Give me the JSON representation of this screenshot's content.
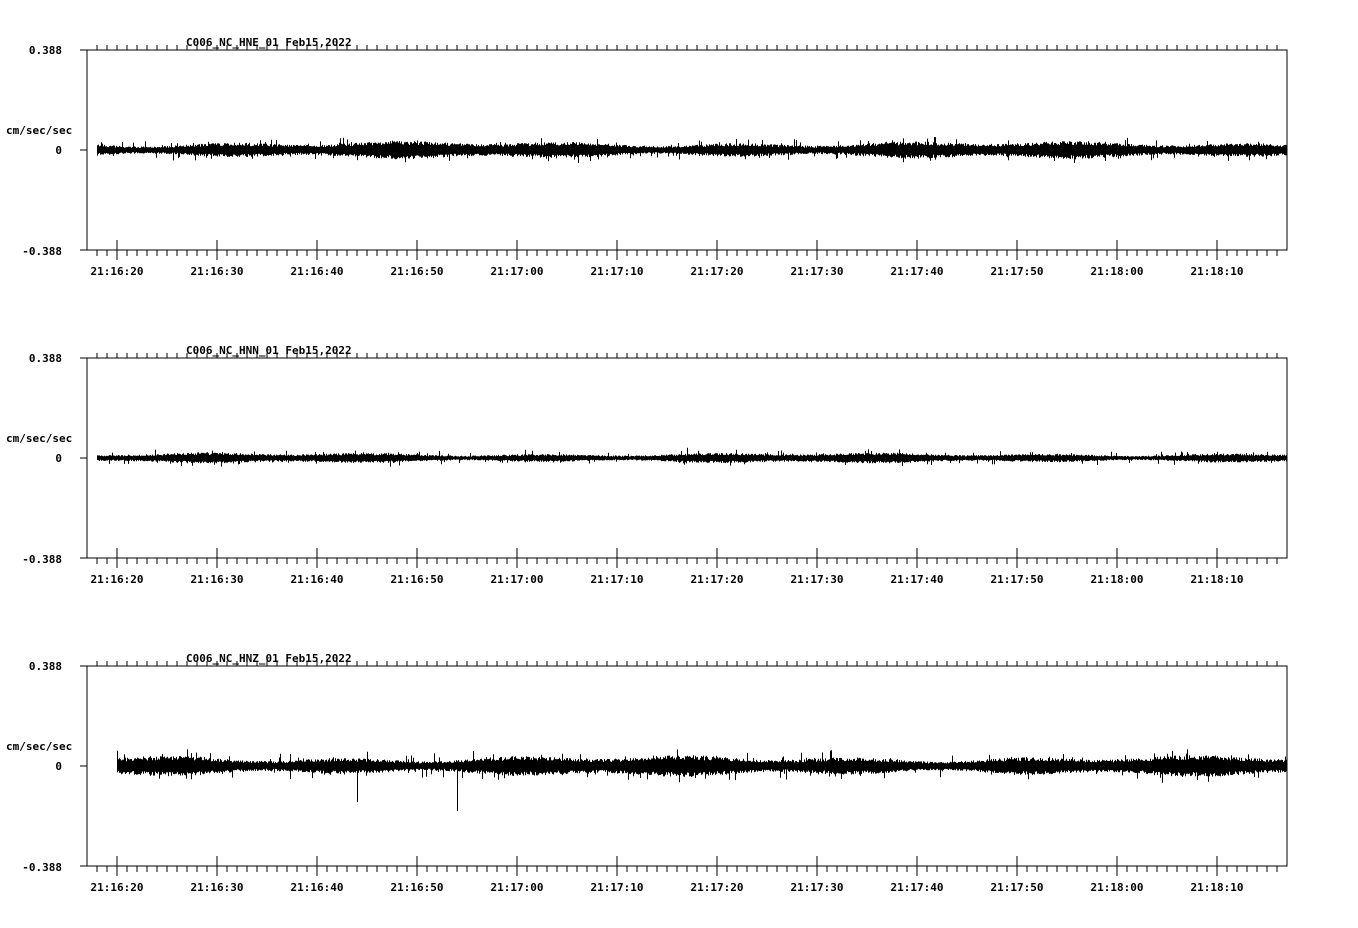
{
  "chart_data": [
    {
      "type": "line",
      "title": "C006_NC_HNE_01   Feb15,2022",
      "channel": "C006_NC_HNE_01",
      "date": "Feb15,2022",
      "ylabel": "cm/sec/sec",
      "ylim": [
        -0.388,
        0.388
      ],
      "yticks": [
        "0.388",
        "0",
        "-0.388"
      ],
      "xlim": [
        "21:16:17",
        "21:18:17"
      ],
      "xticks": [
        "21:16:20",
        "21:16:30",
        "21:16:40",
        "21:16:50",
        "21:17:00",
        "21:17:10",
        "21:17:20",
        "21:17:30",
        "21:17:40",
        "21:17:50",
        "21:18:00",
        "21:18:10"
      ],
      "trace_start": "21:16:18",
      "trace_end": "21:18:17",
      "noise_amplitude": 0.025,
      "peak_amplitude": 0.05,
      "spikes": []
    },
    {
      "type": "line",
      "title": "C006_NC_HNN_01   Feb15,2022",
      "channel": "C006_NC_HNN_01",
      "date": "Feb15,2022",
      "ylabel": "cm/sec/sec",
      "ylim": [
        -0.388,
        0.388
      ],
      "yticks": [
        "0.388",
        "0",
        "-0.388"
      ],
      "xlim": [
        "21:16:17",
        "21:18:17"
      ],
      "xticks": [
        "21:16:20",
        "21:16:30",
        "21:16:40",
        "21:16:50",
        "21:17:00",
        "21:17:10",
        "21:17:20",
        "21:17:30",
        "21:17:40",
        "21:17:50",
        "21:18:00",
        "21:18:10"
      ],
      "trace_start": "21:16:18",
      "trace_end": "21:18:17",
      "noise_amplitude": 0.015,
      "peak_amplitude": 0.035,
      "spikes": [
        {
          "time": "21:17:17",
          "value": 0.04
        }
      ]
    },
    {
      "type": "line",
      "title": "C006_NC_HNZ_01   Feb15,2022",
      "channel": "C006_NC_HNZ_01",
      "date": "Feb15,2022",
      "ylabel": "cm/sec/sec",
      "ylim": [
        -0.388,
        0.388
      ],
      "yticks": [
        "0.388",
        "0",
        "-0.388"
      ],
      "xlim": [
        "21:16:17",
        "21:18:17"
      ],
      "xticks": [
        "21:16:20",
        "21:16:30",
        "21:16:40",
        "21:16:50",
        "21:17:00",
        "21:17:10",
        "21:17:20",
        "21:17:30",
        "21:17:40",
        "21:17:50",
        "21:18:00",
        "21:18:10"
      ],
      "trace_start": "21:16:20",
      "trace_end": "21:18:17",
      "noise_amplitude": 0.03,
      "peak_amplitude": 0.065,
      "spikes": [
        {
          "time": "21:16:44",
          "value": -0.14
        },
        {
          "time": "21:16:54",
          "value": -0.175
        }
      ]
    }
  ]
}
